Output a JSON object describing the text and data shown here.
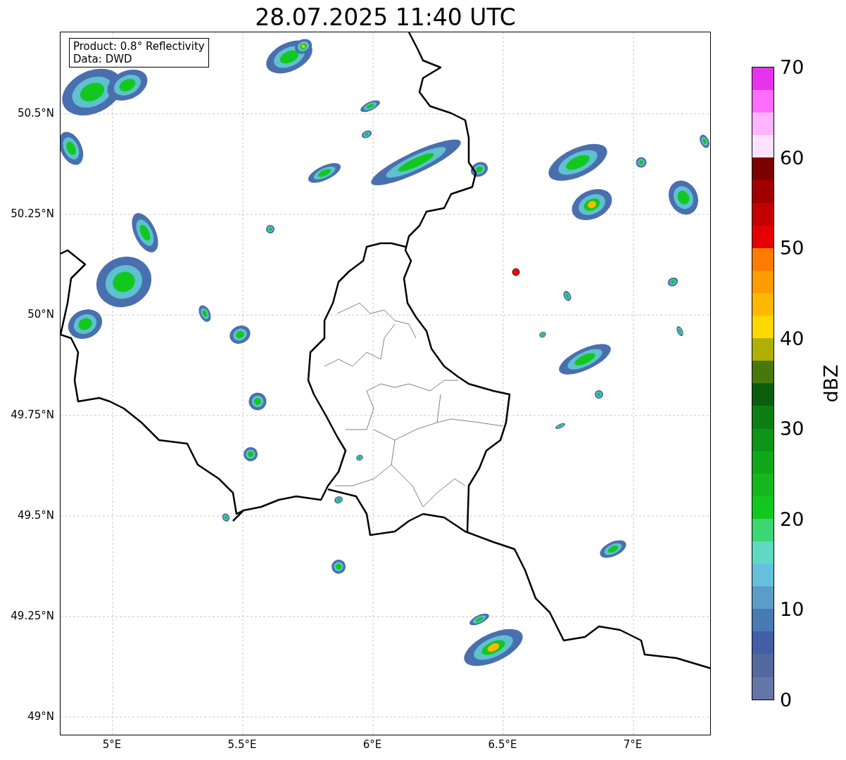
{
  "title": "28.07.2025 11:40 UTC",
  "info_box": [
    "Product: 0.8° Reflectivity",
    "Data: DWD"
  ],
  "y_ticks": [
    "50.5°N",
    "50.25°N",
    "50°N",
    "49.75°N",
    "49.5°N",
    "49.25°N",
    "49°N"
  ],
  "x_ticks": [
    "5°E",
    "5.5°E",
    "6°E",
    "6.5°E",
    "7°E"
  ],
  "colorbar": {
    "label": "dBZ",
    "ticks": [
      "70",
      "60",
      "50",
      "40",
      "30",
      "20",
      "10",
      "0"
    ],
    "bands": [
      {
        "color": "#e634ee"
      },
      {
        "color": "#ff6cff"
      },
      {
        "color": "#ffb4ff"
      },
      {
        "color": "#ffe0ff"
      },
      {
        "color": "#7c0000"
      },
      {
        "color": "#a20000"
      },
      {
        "color": "#c40000"
      },
      {
        "color": "#e40000"
      },
      {
        "color": "#ff7c00"
      },
      {
        "color": "#ff9c00"
      },
      {
        "color": "#ffb800"
      },
      {
        "color": "#ffd800"
      },
      {
        "color": "#b0b004"
      },
      {
        "color": "#48780c"
      },
      {
        "color": "#085e0e"
      },
      {
        "color": "#0c7e12"
      },
      {
        "color": "#0e9416"
      },
      {
        "color": "#10a818"
      },
      {
        "color": "#14b81c"
      },
      {
        "color": "#12c81e"
      },
      {
        "color": "#3cd672"
      },
      {
        "color": "#5fd8c4"
      },
      {
        "color": "#66c0dc"
      },
      {
        "color": "#5a9ec8"
      },
      {
        "color": "#4a7ab4"
      },
      {
        "color": "#425ea4"
      },
      {
        "color": "#5468a0"
      },
      {
        "color": "#6476a8"
      }
    ]
  }
}
